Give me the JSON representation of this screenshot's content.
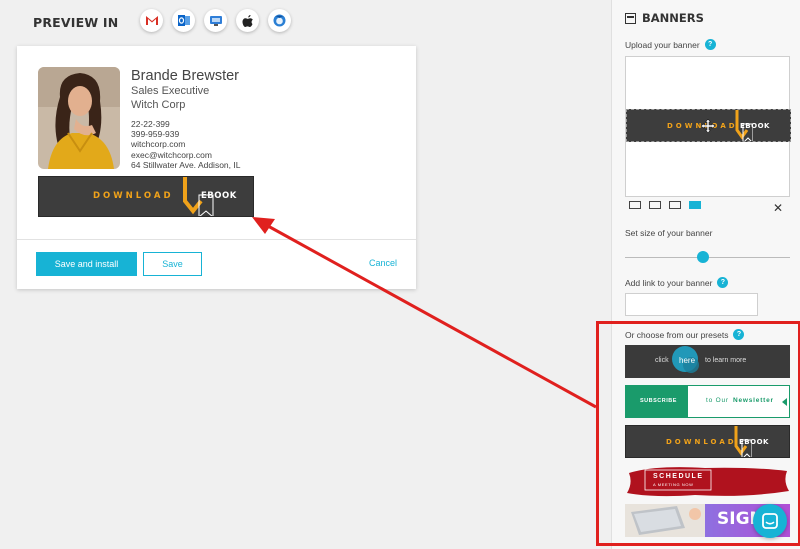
{
  "preview": {
    "title": "PREVIEW IN",
    "clients": [
      "gmail-icon",
      "outlook-icon",
      "windows-mail-icon",
      "apple-mail-icon",
      "thunderbird-icon"
    ]
  },
  "signature": {
    "name": "Brande Brewster",
    "title": "Sales Executive",
    "company": "Witch Corp",
    "phone1": "22-22-399",
    "phone2": "399-959-939",
    "website": "witchcorp.com",
    "email": "exec@witchcorp.com",
    "address": "64 Stillwater Ave. Addison, IL",
    "banner": {
      "download": "DOWNLOAD",
      "ebook": "EBOOK"
    }
  },
  "actions": {
    "save_install": "Save and install",
    "save": "Save",
    "cancel": "Cancel"
  },
  "panel": {
    "title": "BANNERS",
    "upload_label": "Upload your banner",
    "upload_banner": {
      "download": "DOWNLOAD",
      "ebook": "EBOOK"
    },
    "size_label": "Set size of your banner",
    "link_label": "Add link to your banner",
    "presets_label": "Or choose from our presets",
    "presets": {
      "p1_left": "click",
      "p1_mid": "here",
      "p1_right": "to learn more",
      "p2_btn": "SUBSCRIBE",
      "p2_text1": "to Our",
      "p2_text2": "Newsletter",
      "p3_download": "DOWNLOAD",
      "p3_ebook": "EBOOK",
      "p4_line1": "SCHEDULE",
      "p4_line2": "A MEETING NOW",
      "p5_text": "SIGN"
    }
  },
  "colors": {
    "accent": "#17b3d5",
    "highlight": "#e0201e",
    "banner_orange": "#f0a21a",
    "banner_dark": "#3d3d3d"
  }
}
